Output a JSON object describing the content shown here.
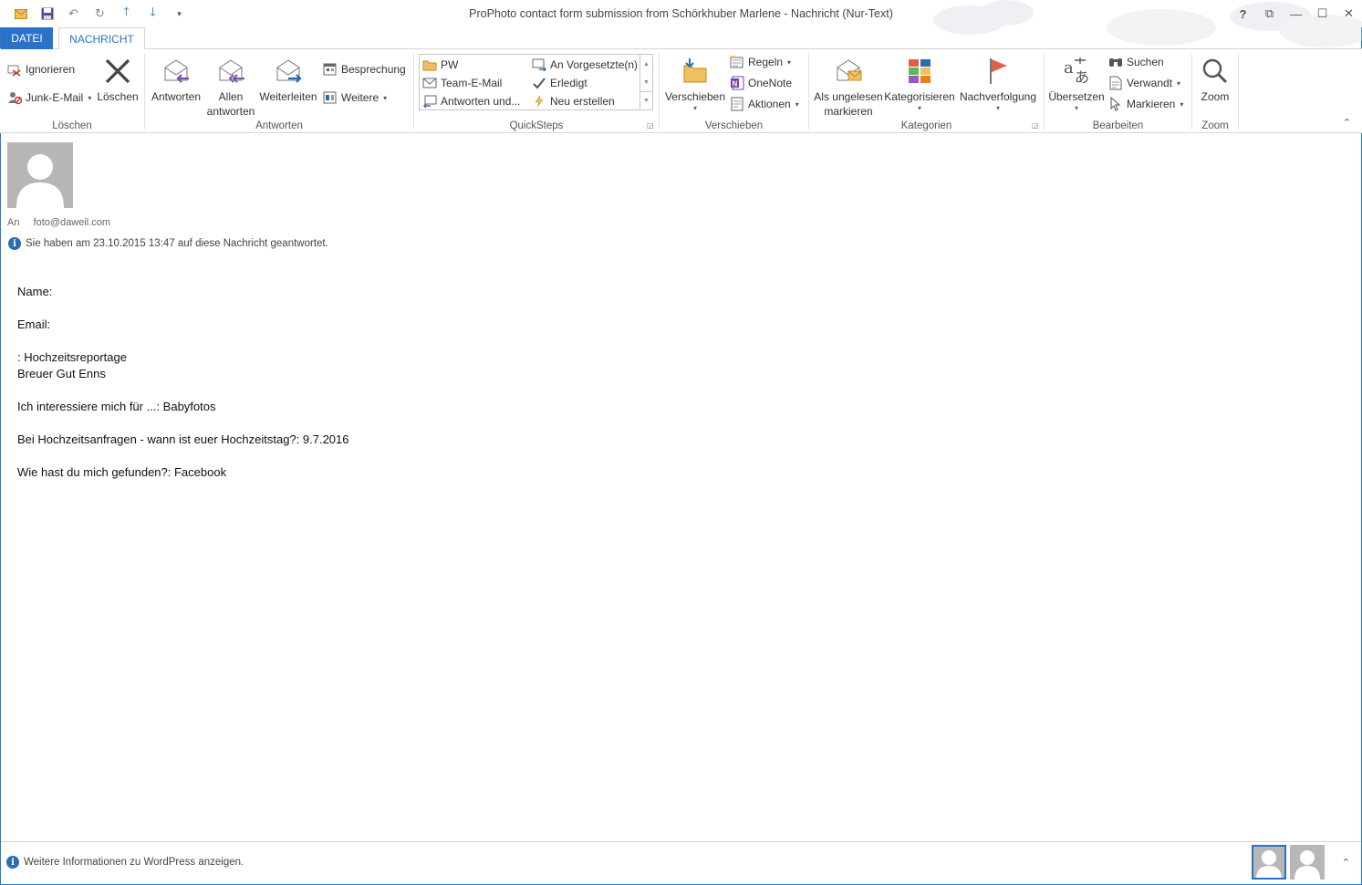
{
  "window": {
    "title": "ProPhoto contact form submission from Schörkhuber Marlene  -  Nachricht (Nur-Text)",
    "controls": {
      "help": "?",
      "ribbon_display": "⧉",
      "minimize": "—",
      "maximize": "☐",
      "close": "✕"
    }
  },
  "qat": {
    "icons": [
      "mail-icon",
      "save-icon",
      "undo-icon",
      "redo-icon",
      "up-arrow-icon",
      "down-arrow-icon",
      "customize-icon"
    ]
  },
  "tabs": {
    "file": "DATEI",
    "message": "NACHRICHT"
  },
  "ribbon": {
    "loeschen": {
      "label": "Löschen",
      "ignore": "Ignorieren",
      "junk": "Junk-E-Mail",
      "delete": "Löschen"
    },
    "antworten": {
      "label": "Antworten",
      "reply": "Antworten",
      "reply_all_1": "Allen",
      "reply_all_2": "antworten",
      "forward": "Weiterleiten",
      "meeting": "Besprechung",
      "more": "Weitere"
    },
    "quicksteps": {
      "label": "QuickSteps",
      "items": [
        "PW",
        "Team-E-Mail",
        "Antworten und...",
        "An Vorgesetzte(n)",
        "Erledigt",
        "Neu erstellen"
      ]
    },
    "verschieben": {
      "label": "Verschieben",
      "move": "Verschieben",
      "rules": "Regeln",
      "onenote": "OneNote",
      "actions": "Aktionen"
    },
    "kategorien": {
      "label": "Kategorien",
      "unread_1": "Als ungelesen",
      "unread_2": "markieren",
      "categorize": "Kategorisieren",
      "followup": "Nachverfolgung"
    },
    "bearbeiten": {
      "label": "Bearbeiten",
      "translate": "Übersetzen",
      "find": "Suchen",
      "related": "Verwandt",
      "select": "Markieren"
    },
    "zoom": {
      "label": "Zoom",
      "zoom": "Zoom"
    }
  },
  "header": {
    "to_label": "An",
    "to_value": "foto@daweil.com",
    "info": "Sie haben am 23.10.2015 13:47 auf diese Nachricht geantwortet."
  },
  "body": {
    "lines": [
      "Name:",
      "Email:",
      ": Hochzeitsreportage",
      "Breuer Gut Enns",
      "Ich interessiere mich für ...: Babyfotos",
      "Bei Hochzeitsanfragen - wann ist euer Hochzeitstag?: 9.7.2016",
      "Wie hast du mich gefunden?: Facebook"
    ]
  },
  "bottom": {
    "info": "Weitere Informationen zu WordPress anzeigen."
  },
  "colors": {
    "accent": "#2a72c8",
    "frame": "#2b79c4"
  }
}
